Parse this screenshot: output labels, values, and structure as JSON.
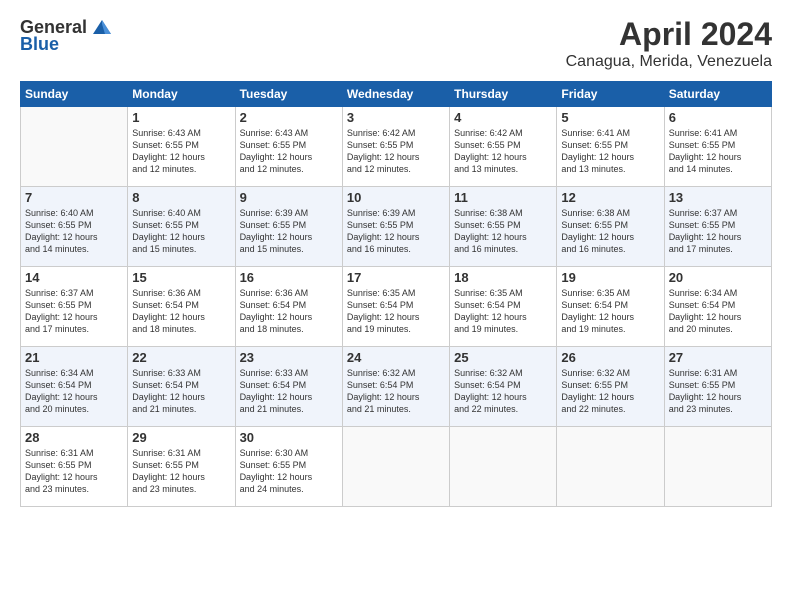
{
  "logo": {
    "general": "General",
    "blue": "Blue"
  },
  "header": {
    "month": "April 2024",
    "location": "Canagua, Merida, Venezuela"
  },
  "columns": [
    "Sunday",
    "Monday",
    "Tuesday",
    "Wednesday",
    "Thursday",
    "Friday",
    "Saturday"
  ],
  "weeks": [
    [
      {
        "day": "",
        "info": ""
      },
      {
        "day": "1",
        "info": "Sunrise: 6:43 AM\nSunset: 6:55 PM\nDaylight: 12 hours\nand 12 minutes."
      },
      {
        "day": "2",
        "info": "Sunrise: 6:43 AM\nSunset: 6:55 PM\nDaylight: 12 hours\nand 12 minutes."
      },
      {
        "day": "3",
        "info": "Sunrise: 6:42 AM\nSunset: 6:55 PM\nDaylight: 12 hours\nand 12 minutes."
      },
      {
        "day": "4",
        "info": "Sunrise: 6:42 AM\nSunset: 6:55 PM\nDaylight: 12 hours\nand 13 minutes."
      },
      {
        "day": "5",
        "info": "Sunrise: 6:41 AM\nSunset: 6:55 PM\nDaylight: 12 hours\nand 13 minutes."
      },
      {
        "day": "6",
        "info": "Sunrise: 6:41 AM\nSunset: 6:55 PM\nDaylight: 12 hours\nand 14 minutes."
      }
    ],
    [
      {
        "day": "7",
        "info": "Sunrise: 6:40 AM\nSunset: 6:55 PM\nDaylight: 12 hours\nand 14 minutes."
      },
      {
        "day": "8",
        "info": "Sunrise: 6:40 AM\nSunset: 6:55 PM\nDaylight: 12 hours\nand 15 minutes."
      },
      {
        "day": "9",
        "info": "Sunrise: 6:39 AM\nSunset: 6:55 PM\nDaylight: 12 hours\nand 15 minutes."
      },
      {
        "day": "10",
        "info": "Sunrise: 6:39 AM\nSunset: 6:55 PM\nDaylight: 12 hours\nand 16 minutes."
      },
      {
        "day": "11",
        "info": "Sunrise: 6:38 AM\nSunset: 6:55 PM\nDaylight: 12 hours\nand 16 minutes."
      },
      {
        "day": "12",
        "info": "Sunrise: 6:38 AM\nSunset: 6:55 PM\nDaylight: 12 hours\nand 16 minutes."
      },
      {
        "day": "13",
        "info": "Sunrise: 6:37 AM\nSunset: 6:55 PM\nDaylight: 12 hours\nand 17 minutes."
      }
    ],
    [
      {
        "day": "14",
        "info": "Sunrise: 6:37 AM\nSunset: 6:55 PM\nDaylight: 12 hours\nand 17 minutes."
      },
      {
        "day": "15",
        "info": "Sunrise: 6:36 AM\nSunset: 6:54 PM\nDaylight: 12 hours\nand 18 minutes."
      },
      {
        "day": "16",
        "info": "Sunrise: 6:36 AM\nSunset: 6:54 PM\nDaylight: 12 hours\nand 18 minutes."
      },
      {
        "day": "17",
        "info": "Sunrise: 6:35 AM\nSunset: 6:54 PM\nDaylight: 12 hours\nand 19 minutes."
      },
      {
        "day": "18",
        "info": "Sunrise: 6:35 AM\nSunset: 6:54 PM\nDaylight: 12 hours\nand 19 minutes."
      },
      {
        "day": "19",
        "info": "Sunrise: 6:35 AM\nSunset: 6:54 PM\nDaylight: 12 hours\nand 19 minutes."
      },
      {
        "day": "20",
        "info": "Sunrise: 6:34 AM\nSunset: 6:54 PM\nDaylight: 12 hours\nand 20 minutes."
      }
    ],
    [
      {
        "day": "21",
        "info": "Sunrise: 6:34 AM\nSunset: 6:54 PM\nDaylight: 12 hours\nand 20 minutes."
      },
      {
        "day": "22",
        "info": "Sunrise: 6:33 AM\nSunset: 6:54 PM\nDaylight: 12 hours\nand 21 minutes."
      },
      {
        "day": "23",
        "info": "Sunrise: 6:33 AM\nSunset: 6:54 PM\nDaylight: 12 hours\nand 21 minutes."
      },
      {
        "day": "24",
        "info": "Sunrise: 6:32 AM\nSunset: 6:54 PM\nDaylight: 12 hours\nand 21 minutes."
      },
      {
        "day": "25",
        "info": "Sunrise: 6:32 AM\nSunset: 6:54 PM\nDaylight: 12 hours\nand 22 minutes."
      },
      {
        "day": "26",
        "info": "Sunrise: 6:32 AM\nSunset: 6:55 PM\nDaylight: 12 hours\nand 22 minutes."
      },
      {
        "day": "27",
        "info": "Sunrise: 6:31 AM\nSunset: 6:55 PM\nDaylight: 12 hours\nand 23 minutes."
      }
    ],
    [
      {
        "day": "28",
        "info": "Sunrise: 6:31 AM\nSunset: 6:55 PM\nDaylight: 12 hours\nand 23 minutes."
      },
      {
        "day": "29",
        "info": "Sunrise: 6:31 AM\nSunset: 6:55 PM\nDaylight: 12 hours\nand 23 minutes."
      },
      {
        "day": "30",
        "info": "Sunrise: 6:30 AM\nSunset: 6:55 PM\nDaylight: 12 hours\nand 24 minutes."
      },
      {
        "day": "",
        "info": ""
      },
      {
        "day": "",
        "info": ""
      },
      {
        "day": "",
        "info": ""
      },
      {
        "day": "",
        "info": ""
      }
    ]
  ]
}
